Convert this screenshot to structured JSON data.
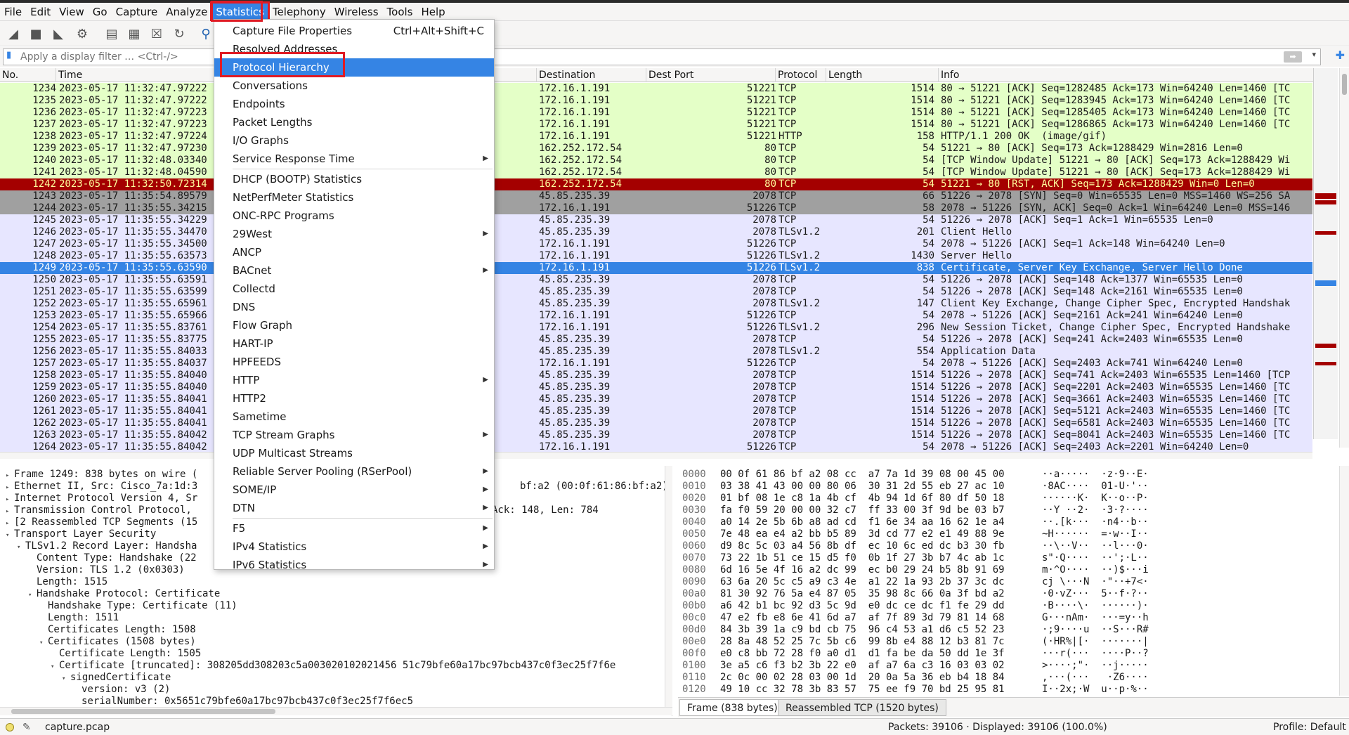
{
  "menubar": [
    "File",
    "Edit",
    "View",
    "Go",
    "Capture",
    "Analyze",
    "Statistics",
    "Telephony",
    "Wireless",
    "Tools",
    "Help"
  ],
  "filter": {
    "placeholder": "Apply a display filter … <Ctrl-/>"
  },
  "packet_list": {
    "columns": [
      "No.",
      "Time",
      "Destination",
      "Dest Port",
      "Protocol",
      "Length",
      "Info"
    ],
    "rows": [
      {
        "no": "1234",
        "time": "2023-05-17 11:32:47.97222",
        "dst": "172.16.1.191",
        "dport": "51221",
        "proto": "TCP",
        "len": "1514",
        "info": "80 → 51221 [ACK] Seq=1282485 Ack=173 Win=64240 Len=1460 [TC",
        "style": "green"
      },
      {
        "no": "1235",
        "time": "2023-05-17 11:32:47.97222",
        "dst": "172.16.1.191",
        "dport": "51221",
        "proto": "TCP",
        "len": "1514",
        "info": "80 → 51221 [ACK] Seq=1283945 Ack=173 Win=64240 Len=1460 [TC",
        "style": "green"
      },
      {
        "no": "1236",
        "time": "2023-05-17 11:32:47.97223",
        "dst": "172.16.1.191",
        "dport": "51221",
        "proto": "TCP",
        "len": "1514",
        "info": "80 → 51221 [ACK] Seq=1285405 Ack=173 Win=64240 Len=1460 [TC",
        "style": "green"
      },
      {
        "no": "1237",
        "time": "2023-05-17 11:32:47.97223",
        "dst": "172.16.1.191",
        "dport": "51221",
        "proto": "TCP",
        "len": "1514",
        "info": "80 → 51221 [ACK] Seq=1286865 Ack=173 Win=64240 Len=1460 [TC",
        "style": "green"
      },
      {
        "no": "1238",
        "time": "2023-05-17 11:32:47.97224",
        "dst": "172.16.1.191",
        "dport": "51221",
        "proto": "HTTP",
        "len": "158",
        "info": "HTTP/1.1 200 OK  (image/gif)",
        "style": "green"
      },
      {
        "no": "1239",
        "time": "2023-05-17 11:32:47.97230",
        "dst": "162.252.172.54",
        "dport": "80",
        "proto": "TCP",
        "len": "54",
        "info": "51221 → 80 [ACK] Seq=173 Ack=1288429 Win=2816 Len=0",
        "style": "green"
      },
      {
        "no": "1240",
        "time": "2023-05-17 11:32:48.03340",
        "dst": "162.252.172.54",
        "dport": "80",
        "proto": "TCP",
        "len": "54",
        "info": "[TCP Window Update] 51221 → 80 [ACK] Seq=173 Ack=1288429 Wi",
        "style": "green"
      },
      {
        "no": "1241",
        "time": "2023-05-17 11:32:48.04590",
        "dst": "162.252.172.54",
        "dport": "80",
        "proto": "TCP",
        "len": "54",
        "info": "[TCP Window Update] 51221 → 80 [ACK] Seq=173 Ack=1288429 Wi",
        "style": "green"
      },
      {
        "no": "1242",
        "time": "2023-05-17 11:32:50.72314",
        "dst": "162.252.172.54",
        "dport": "80",
        "proto": "TCP",
        "len": "54",
        "info": "51221 → 80 [RST, ACK] Seq=173 Ack=1288429 Win=0 Len=0",
        "style": "red"
      },
      {
        "no": "1243",
        "time": "2023-05-17 11:35:54.89579",
        "dst": "45.85.235.39",
        "dport": "2078",
        "proto": "TCP",
        "len": "66",
        "info": "51226 → 2078 [SYN] Seq=0 Win=65535 Len=0 MSS=1460 WS=256 SA",
        "style": "gray"
      },
      {
        "no": "1244",
        "time": "2023-05-17 11:35:55.34215",
        "dst": "172.16.1.191",
        "dport": "51226",
        "proto": "TCP",
        "len": "58",
        "info": "2078 → 51226 [SYN, ACK] Seq=0 Ack=1 Win=64240 Len=0 MSS=146",
        "style": "gray"
      },
      {
        "no": "1245",
        "time": "2023-05-17 11:35:55.34229",
        "dst": "45.85.235.39",
        "dport": "2078",
        "proto": "TCP",
        "len": "54",
        "info": "51226 → 2078 [ACK] Seq=1 Ack=1 Win=65535 Len=0",
        "style": "blue"
      },
      {
        "no": "1246",
        "time": "2023-05-17 11:35:55.34470",
        "dst": "45.85.235.39",
        "dport": "2078",
        "proto": "TLSv1.2",
        "len": "201",
        "info": "Client Hello",
        "style": "blue"
      },
      {
        "no": "1247",
        "time": "2023-05-17 11:35:55.34500",
        "dst": "172.16.1.191",
        "dport": "51226",
        "proto": "TCP",
        "len": "54",
        "info": "2078 → 51226 [ACK] Seq=1 Ack=148 Win=64240 Len=0",
        "style": "blue"
      },
      {
        "no": "1248",
        "time": "2023-05-17 11:35:55.63573",
        "dst": "172.16.1.191",
        "dport": "51226",
        "proto": "TLSv1.2",
        "len": "1430",
        "info": "Server Hello",
        "style": "blue"
      },
      {
        "no": "1249",
        "time": "2023-05-17 11:35:55.63590",
        "dst": "172.16.1.191",
        "dport": "51226",
        "proto": "TLSv1.2",
        "len": "838",
        "info": "Certificate, Server Key Exchange, Server Hello Done",
        "style": "sel"
      },
      {
        "no": "1250",
        "time": "2023-05-17 11:35:55.63591",
        "dst": "45.85.235.39",
        "dport": "2078",
        "proto": "TCP",
        "len": "54",
        "info": "51226 → 2078 [ACK] Seq=148 Ack=1377 Win=65535 Len=0",
        "style": "blue"
      },
      {
        "no": "1251",
        "time": "2023-05-17 11:35:55.63599",
        "dst": "45.85.235.39",
        "dport": "2078",
        "proto": "TCP",
        "len": "54",
        "info": "51226 → 2078 [ACK] Seq=148 Ack=2161 Win=65535 Len=0",
        "style": "blue"
      },
      {
        "no": "1252",
        "time": "2023-05-17 11:35:55.65961",
        "dst": "45.85.235.39",
        "dport": "2078",
        "proto": "TLSv1.2",
        "len": "147",
        "info": "Client Key Exchange, Change Cipher Spec, Encrypted Handshak",
        "style": "blue"
      },
      {
        "no": "1253",
        "time": "2023-05-17 11:35:55.65966",
        "dst": "172.16.1.191",
        "dport": "51226",
        "proto": "TCP",
        "len": "54",
        "info": "2078 → 51226 [ACK] Seq=2161 Ack=241 Win=64240 Len=0",
        "style": "blue"
      },
      {
        "no": "1254",
        "time": "2023-05-17 11:35:55.83761",
        "dst": "172.16.1.191",
        "dport": "51226",
        "proto": "TLSv1.2",
        "len": "296",
        "info": "New Session Ticket, Change Cipher Spec, Encrypted Handshake",
        "style": "blue"
      },
      {
        "no": "1255",
        "time": "2023-05-17 11:35:55.83775",
        "dst": "45.85.235.39",
        "dport": "2078",
        "proto": "TCP",
        "len": "54",
        "info": "51226 → 2078 [ACK] Seq=241 Ack=2403 Win=65535 Len=0",
        "style": "blue"
      },
      {
        "no": "1256",
        "time": "2023-05-17 11:35:55.84033",
        "dst": "45.85.235.39",
        "dport": "2078",
        "proto": "TLSv1.2",
        "len": "554",
        "info": "Application Data",
        "style": "blue"
      },
      {
        "no": "1257",
        "time": "2023-05-17 11:35:55.84037",
        "dst": "172.16.1.191",
        "dport": "51226",
        "proto": "TCP",
        "len": "54",
        "info": "2078 → 51226 [ACK] Seq=2403 Ack=741 Win=64240 Len=0",
        "style": "blue"
      },
      {
        "no": "1258",
        "time": "2023-05-17 11:35:55.84040",
        "dst": "45.85.235.39",
        "dport": "2078",
        "proto": "TCP",
        "len": "1514",
        "info": "51226 → 2078 [ACK] Seq=741 Ack=2403 Win=65535 Len=1460 [TCP",
        "style": "blue"
      },
      {
        "no": "1259",
        "time": "2023-05-17 11:35:55.84040",
        "dst": "45.85.235.39",
        "dport": "2078",
        "proto": "TCP",
        "len": "1514",
        "info": "51226 → 2078 [ACK] Seq=2201 Ack=2403 Win=65535 Len=1460 [TC",
        "style": "blue"
      },
      {
        "no": "1260",
        "time": "2023-05-17 11:35:55.84041",
        "dst": "45.85.235.39",
        "dport": "2078",
        "proto": "TCP",
        "len": "1514",
        "info": "51226 → 2078 [ACK] Seq=3661 Ack=2403 Win=65535 Len=1460 [TC",
        "style": "blue"
      },
      {
        "no": "1261",
        "time": "2023-05-17 11:35:55.84041",
        "dst": "45.85.235.39",
        "dport": "2078",
        "proto": "TCP",
        "len": "1514",
        "info": "51226 → 2078 [ACK] Seq=5121 Ack=2403 Win=65535 Len=1460 [TC",
        "style": "blue"
      },
      {
        "no": "1262",
        "time": "2023-05-17 11:35:55.84041",
        "dst": "45.85.235.39",
        "dport": "2078",
        "proto": "TCP",
        "len": "1514",
        "info": "51226 → 2078 [ACK] Seq=6581 Ack=2403 Win=65535 Len=1460 [TC",
        "style": "blue"
      },
      {
        "no": "1263",
        "time": "2023-05-17 11:35:55.84042",
        "dst": "45.85.235.39",
        "dport": "2078",
        "proto": "TCP",
        "len": "1514",
        "info": "51226 → 2078 [ACK] Seq=8041 Ack=2403 Win=65535 Len=1460 [TC",
        "style": "blue"
      },
      {
        "no": "1264",
        "time": "2023-05-17 11:35:55.84042",
        "dst": "172.16.1.191",
        "dport": "51226",
        "proto": "TCP",
        "len": "54",
        "info": "2078 → 51226 [ACK] Seq=2403 Ack=2201 Win=64240 Len=0",
        "style": "blue"
      }
    ]
  },
  "details": [
    {
      "indent": 0,
      "exp": "closed",
      "text": "Frame 1249: 838 bytes on wire ("
    },
    {
      "indent": 0,
      "exp": "closed",
      "text": "Ethernet II, Src: Cisco_7a:1d:3",
      "tail": "bf:a2 (00:0f:61:86:bf:a2)"
    },
    {
      "indent": 0,
      "exp": "closed",
      "text": "Internet Protocol Version 4, Sr"
    },
    {
      "indent": 0,
      "exp": "closed",
      "text": "Transmission Control Protocol,",
      "tail": "Ack: 148, Len: 784"
    },
    {
      "indent": 0,
      "exp": "closed",
      "text": "[2 Reassembled TCP Segments (15"
    },
    {
      "indent": 0,
      "exp": "open",
      "text": "Transport Layer Security"
    },
    {
      "indent": 1,
      "exp": "open",
      "text": "TLSv1.2 Record Layer: Handsha"
    },
    {
      "indent": 2,
      "exp": "none",
      "text": "Content Type: Handshake (22"
    },
    {
      "indent": 2,
      "exp": "none",
      "text": "Version: TLS 1.2 (0x0303)"
    },
    {
      "indent": 2,
      "exp": "none",
      "text": "Length: 1515"
    },
    {
      "indent": 2,
      "exp": "open",
      "text": "Handshake Protocol: Certificate"
    },
    {
      "indent": 3,
      "exp": "none",
      "text": "Handshake Type: Certificate (11)"
    },
    {
      "indent": 3,
      "exp": "none",
      "text": "Length: 1511"
    },
    {
      "indent": 3,
      "exp": "none",
      "text": "Certificates Length: 1508"
    },
    {
      "indent": 3,
      "exp": "open",
      "text": "Certificates (1508 bytes)"
    },
    {
      "indent": 4,
      "exp": "none",
      "text": "Certificate Length: 1505"
    },
    {
      "indent": 4,
      "exp": "open",
      "text": "Certificate [truncated]: 308205dd308203c5a003020102021456 51c79bfe60a17bc97bcb437c0f3ec25f7f6e"
    },
    {
      "indent": 5,
      "exp": "open",
      "text": "signedCertificate"
    },
    {
      "indent": 6,
      "exp": "none",
      "text": "version: v3 (2)"
    },
    {
      "indent": 6,
      "exp": "none",
      "text": "serialNumber: 0x5651c79bfe60a17bc97bcb437c0f3ec25f7f6ec5"
    }
  ],
  "bytes": [
    {
      "off": "0000",
      "hex": "00 0f 61 86 bf a2 08 cc  a7 7a 1d 39 08 00 45 00",
      "asc": "··a·····  ·z·9··E·"
    },
    {
      "off": "0010",
      "hex": "03 38 41 43 00 00 80 06  30 31 2d 55 eb 27 ac 10",
      "asc": "·8AC····  01-U·'··"
    },
    {
      "off": "0020",
      "hex": "01 bf 08 1e c8 1a 4b cf  4b 94 1d 6f 80 df 50 18",
      "asc": "······K·  K··o··P·"
    },
    {
      "off": "0030",
      "hex": "fa f0 59 20 00 00 32 c7  ff 33 00 3f 9d be 03 b7",
      "asc": "··Y ··2·  ·3·?····"
    },
    {
      "off": "0040",
      "hex": "a0 14 2e 5b 6b a8 ad cd  f1 6e 34 aa 16 62 1e a4",
      "asc": "··.[k···  ·n4··b··"
    },
    {
      "off": "0050",
      "hex": "7e 48 ea e4 a2 bb b5 89  3d cd 77 e2 e1 49 88 9e",
      "asc": "~H······  =·w··I··"
    },
    {
      "off": "0060",
      "hex": "d9 8c 5c 03 a4 56 8b df  ec 10 6c ed dc b3 30 fb",
      "asc": "··\\··V··  ··l···0·"
    },
    {
      "off": "0070",
      "hex": "73 22 1b 51 ce 15 d5 f0  0b 1f 27 3b b7 4c ab 1c",
      "asc": "s\"·Q····  ··';·L··"
    },
    {
      "off": "0080",
      "hex": "6d 16 5e 4f 16 a2 dc 99  ec b0 29 24 b5 8b 91 69",
      "asc": "m·^O····  ··)$···i"
    },
    {
      "off": "0090",
      "hex": "63 6a 20 5c c5 a9 c3 4e  a1 22 1a 93 2b 37 3c dc",
      "asc": "cj \\···N  ·\"··+7<·"
    },
    {
      "off": "00a0",
      "hex": "81 30 92 76 5a e4 87 05  35 98 8c 66 0a 3f bd a2",
      "asc": "·0·vZ···  5··f·?··"
    },
    {
      "off": "00b0",
      "hex": "a6 42 b1 bc 92 d3 5c 9d  e0 dc ce dc f1 fe 29 dd",
      "asc": "·B····\\·  ······)·"
    },
    {
      "off": "00c0",
      "hex": "47 e2 fb e8 6e 41 6d a7  af 7f 89 3d 79 81 14 68",
      "asc": "G···nAm·  ···=y··h"
    },
    {
      "off": "00d0",
      "hex": "84 3b 39 1a c9 bd cb 75  96 c4 53 a1 d6 c5 52 23",
      "asc": "·;9····u  ··S···R#"
    },
    {
      "off": "00e0",
      "hex": "28 8a 48 52 25 7c 5b c6  99 8b e4 88 12 b3 81 7c",
      "asc": "(·HR%|[·  ·······|"
    },
    {
      "off": "00f0",
      "hex": "e0 c8 bb 72 28 f0 a0 d1  d1 fa be da 50 dd 1e 3f",
      "asc": "···r(···  ····P··?"
    },
    {
      "off": "0100",
      "hex": "3e a5 c6 f3 b2 3b 22 e0  af a7 6a c3 16 03 03 02",
      "asc": ">····;\"·  ··j·····"
    },
    {
      "off": "0110",
      "hex": "2c 0c 00 02 28 03 00 1d  20 0a 5a 36 eb b4 18 84",
      "asc": ",···(···   ·Z6····"
    },
    {
      "off": "0120",
      "hex": "49 10 cc 32 78 3b 83 57  75 ee f9 70 bd 25 95 81",
      "asc": "I··2x;·W  u··p·%··"
    }
  ],
  "bytes_tabs": [
    "Frame (838 bytes)",
    "Reassembled TCP (1520 bytes)"
  ],
  "status": {
    "file": "capture.pcap",
    "packets": "Packets: 39106 · Displayed: 39106 (100.0%)",
    "profile": "Profile: Default"
  },
  "stats_menu": [
    {
      "label": "Capture File Properties",
      "shortcut": "Ctrl+Alt+Shift+C"
    },
    {
      "label": "Resolved Addresses"
    },
    {
      "label": "Protocol Hierarchy",
      "highlight": true
    },
    {
      "label": "Conversations"
    },
    {
      "label": "Endpoints"
    },
    {
      "label": "Packet Lengths"
    },
    {
      "label": "I/O Graphs"
    },
    {
      "label": "Service Response Time",
      "submenu": true
    },
    {
      "sep": true
    },
    {
      "label": "DHCP (BOOTP) Statistics"
    },
    {
      "label": "NetPerfMeter Statistics"
    },
    {
      "label": "ONC-RPC Programs"
    },
    {
      "label": "29West",
      "submenu": true
    },
    {
      "label": "ANCP"
    },
    {
      "label": "BACnet",
      "submenu": true
    },
    {
      "label": "Collectd"
    },
    {
      "label": "DNS"
    },
    {
      "label": "Flow Graph"
    },
    {
      "label": "HART-IP"
    },
    {
      "label": "HPFEEDS"
    },
    {
      "label": "HTTP",
      "submenu": true
    },
    {
      "label": "HTTP2"
    },
    {
      "label": "Sametime"
    },
    {
      "label": "TCP Stream Graphs",
      "submenu": true
    },
    {
      "label": "UDP Multicast Streams"
    },
    {
      "label": "Reliable Server Pooling (RSerPool)",
      "submenu": true
    },
    {
      "label": "SOME/IP",
      "submenu": true
    },
    {
      "label": "DTN",
      "submenu": true
    },
    {
      "sep": true
    },
    {
      "label": "F5",
      "submenu": true
    },
    {
      "label": "IPv4 Statistics",
      "submenu": true
    },
    {
      "label": "IPv6 Statistics",
      "submenu": true
    }
  ],
  "colors": {
    "accent": "#3584e4",
    "highlight_box": "#e01b24",
    "row_green": "#e4ffc7",
    "row_blue": "#e7e6ff",
    "row_red": "#a40000",
    "row_gray": "#a0a0a0"
  }
}
